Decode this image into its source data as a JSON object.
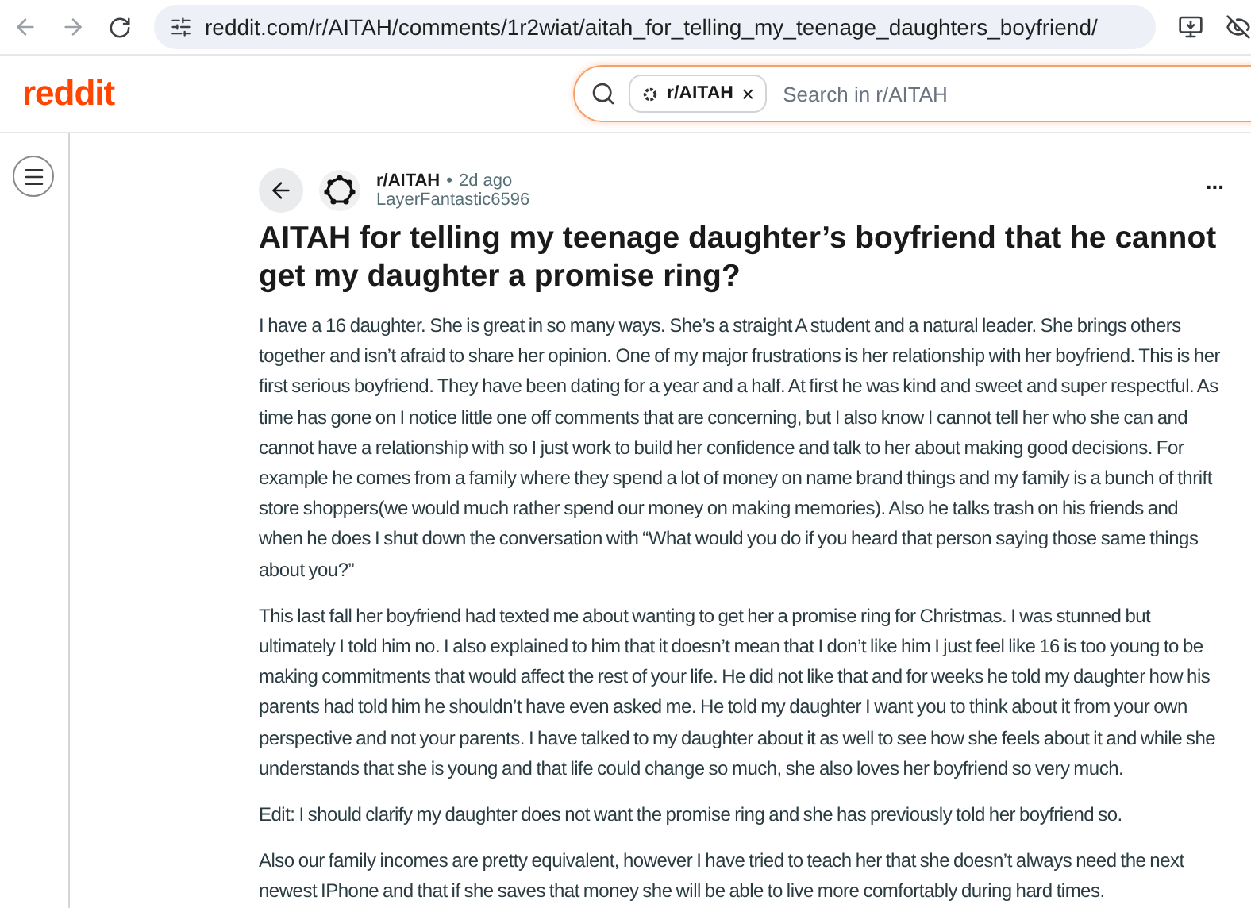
{
  "browser": {
    "url": "reddit.com/r/AITAH/comments/1r2wiat/aitah_for_telling_my_teenage_daughters_boyfriend/"
  },
  "header": {
    "logo": "reddit",
    "search": {
      "chip": "r/AITAH",
      "chip_close": "×",
      "placeholder": "Search in r/AITAH"
    }
  },
  "post": {
    "subreddit": "r/AITAH",
    "separator": "•",
    "age": "2d ago",
    "author": "LayerFantastic6596",
    "more": "...",
    "title": "AITAH for telling my teenage daughter’s boyfriend that he cannot get my daughter a promise ring?",
    "paragraphs": [
      "I have a 16 daughter. She is great in so many ways. She’s a straight A student and a natural leader. She brings others together and isn’t afraid to share her opinion. One of my major frustrations is her relationship with her boyfriend. This is her first serious boyfriend. They have been dating for a year and a half. At first he was kind and sweet and super respectful. As time has gone on I notice little one off comments that are concerning, but I also know I cannot tell her who she can and cannot have a relationship with so I just work to build her confidence and talk to her about making good decisions. For example he comes from a family where they spend a lot of money on name brand things and my family is a bunch of thrift store shoppers(we would much rather spend our money on making memories). Also he talks trash on his friends and when he does I shut down the conversation with “What would you do if you heard that person saying those same things about you?”",
      "This last fall her boyfriend had texted me about wanting to get her a promise ring for Christmas. I was stunned but ultimately I told him no. I also explained to him that it doesn’t mean that I don’t like him I just feel like 16 is too young to be making commitments that would affect the rest of your life. He did not like that and for weeks he told my daughter how his parents had told him he shouldn’t have even asked me. He told my daughter I want you to think about it from your own perspective and not your parents. I have talked to my daughter about it as well to see how she feels about it and while she understands that she is young and that life could change so much, she also loves her boyfriend so very much.",
      "Edit: I should clarify my daughter does not want the promise ring and she has previously told her boyfriend so.",
      "Also our family incomes are pretty equivalent, however I have tried to teach her that she doesn’t always need the next newest IPhone and that if she saves that money she will be able to live more comfortably during hard times."
    ]
  }
}
